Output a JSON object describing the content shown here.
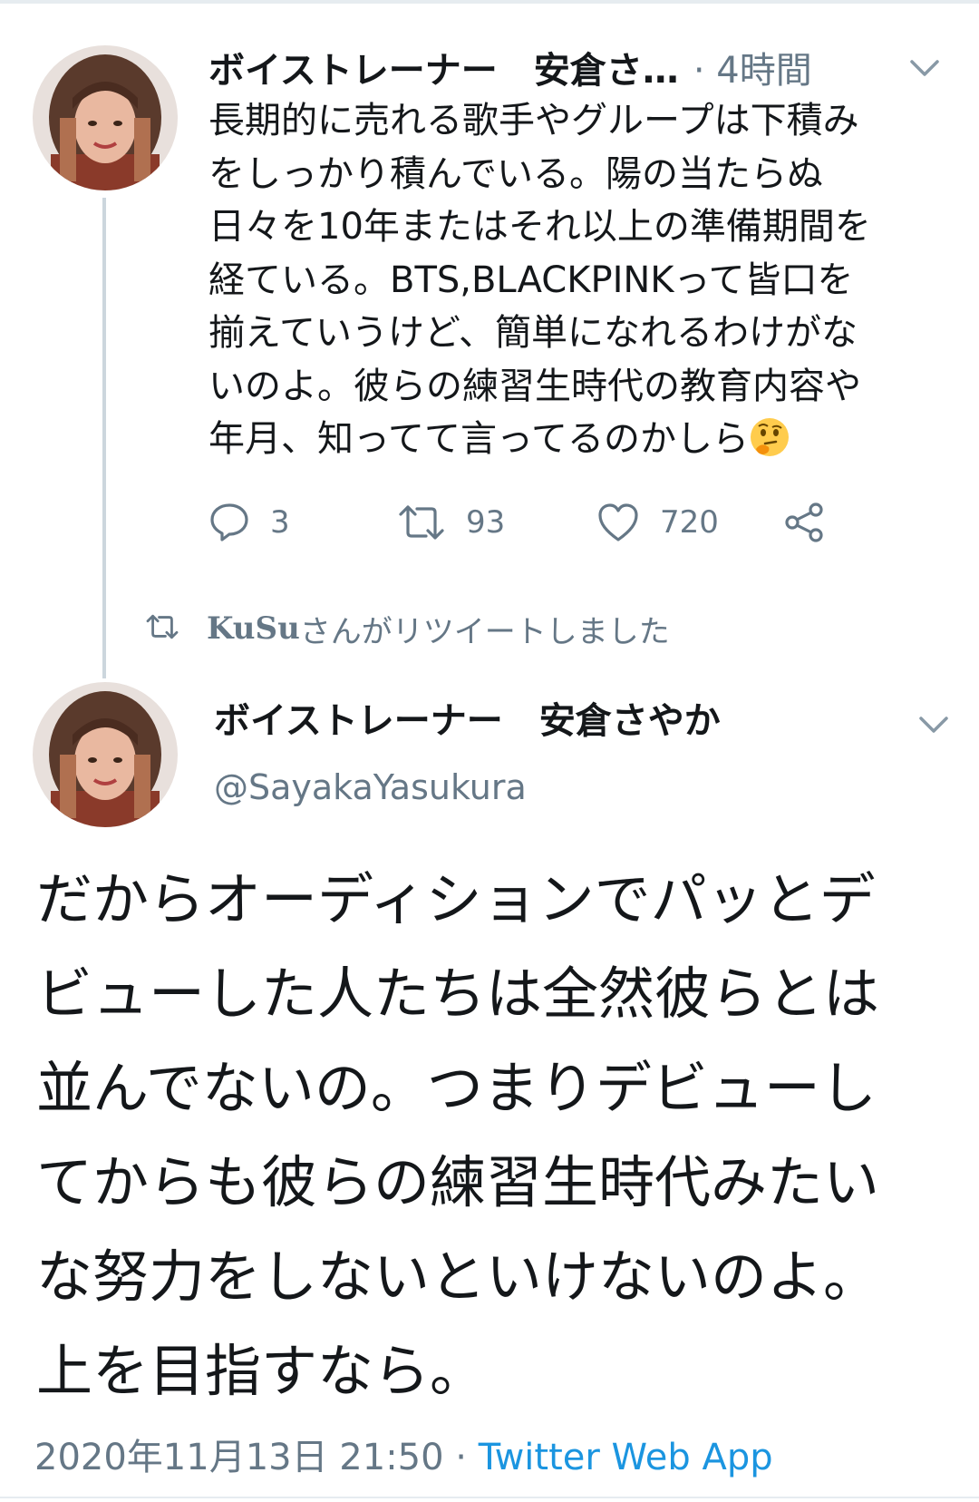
{
  "tweet1": {
    "author_name": "ボイストレーナー　安倉さ…",
    "time": "· 4時間",
    "body": "長期的に売れる歌手やグループは下積み\nをしっかり積んでいる。陽の当たらぬ\n日々を10年またはそれ以上の準備期間を\n経ている。BTS,BLACKPINKって皆口を\n揃えていうけど、簡単になれるわけがな\nいのよ。彼らの練習生時代の教育内容や\n年月、知ってて言ってるのかしら",
    "emoji": "thinking-face-emoji",
    "actions": {
      "reply_count": "3",
      "retweet_count": "93",
      "like_count": "720"
    }
  },
  "retweet_notice": {
    "user": "KuSu",
    "text": "さんがリツイートしました"
  },
  "tweet2": {
    "author_name": "ボイストレーナー　安倉さやか",
    "handle": "@SayakaYasukura",
    "body": "だからオーディションでパッとデ\nビューした人たちは全然彼らとは\n並んでないの。つまりデビューし\nてからも彼らの練習生時代みたい\nな努力をしないといけないのよ。\n上を目指すなら。",
    "timestamp": "2020年11月13日 21:50",
    "separator": " · ",
    "source": "Twitter Web App"
  },
  "icons": {
    "reply": "reply-icon",
    "retweet": "retweet-icon",
    "like": "heart-icon",
    "share": "share-icon",
    "more": "chevron-down-icon"
  },
  "colors": {
    "text": "#14171a",
    "secondary": "#657786",
    "link": "#1b95e0",
    "divider": "#ccd6dd"
  }
}
